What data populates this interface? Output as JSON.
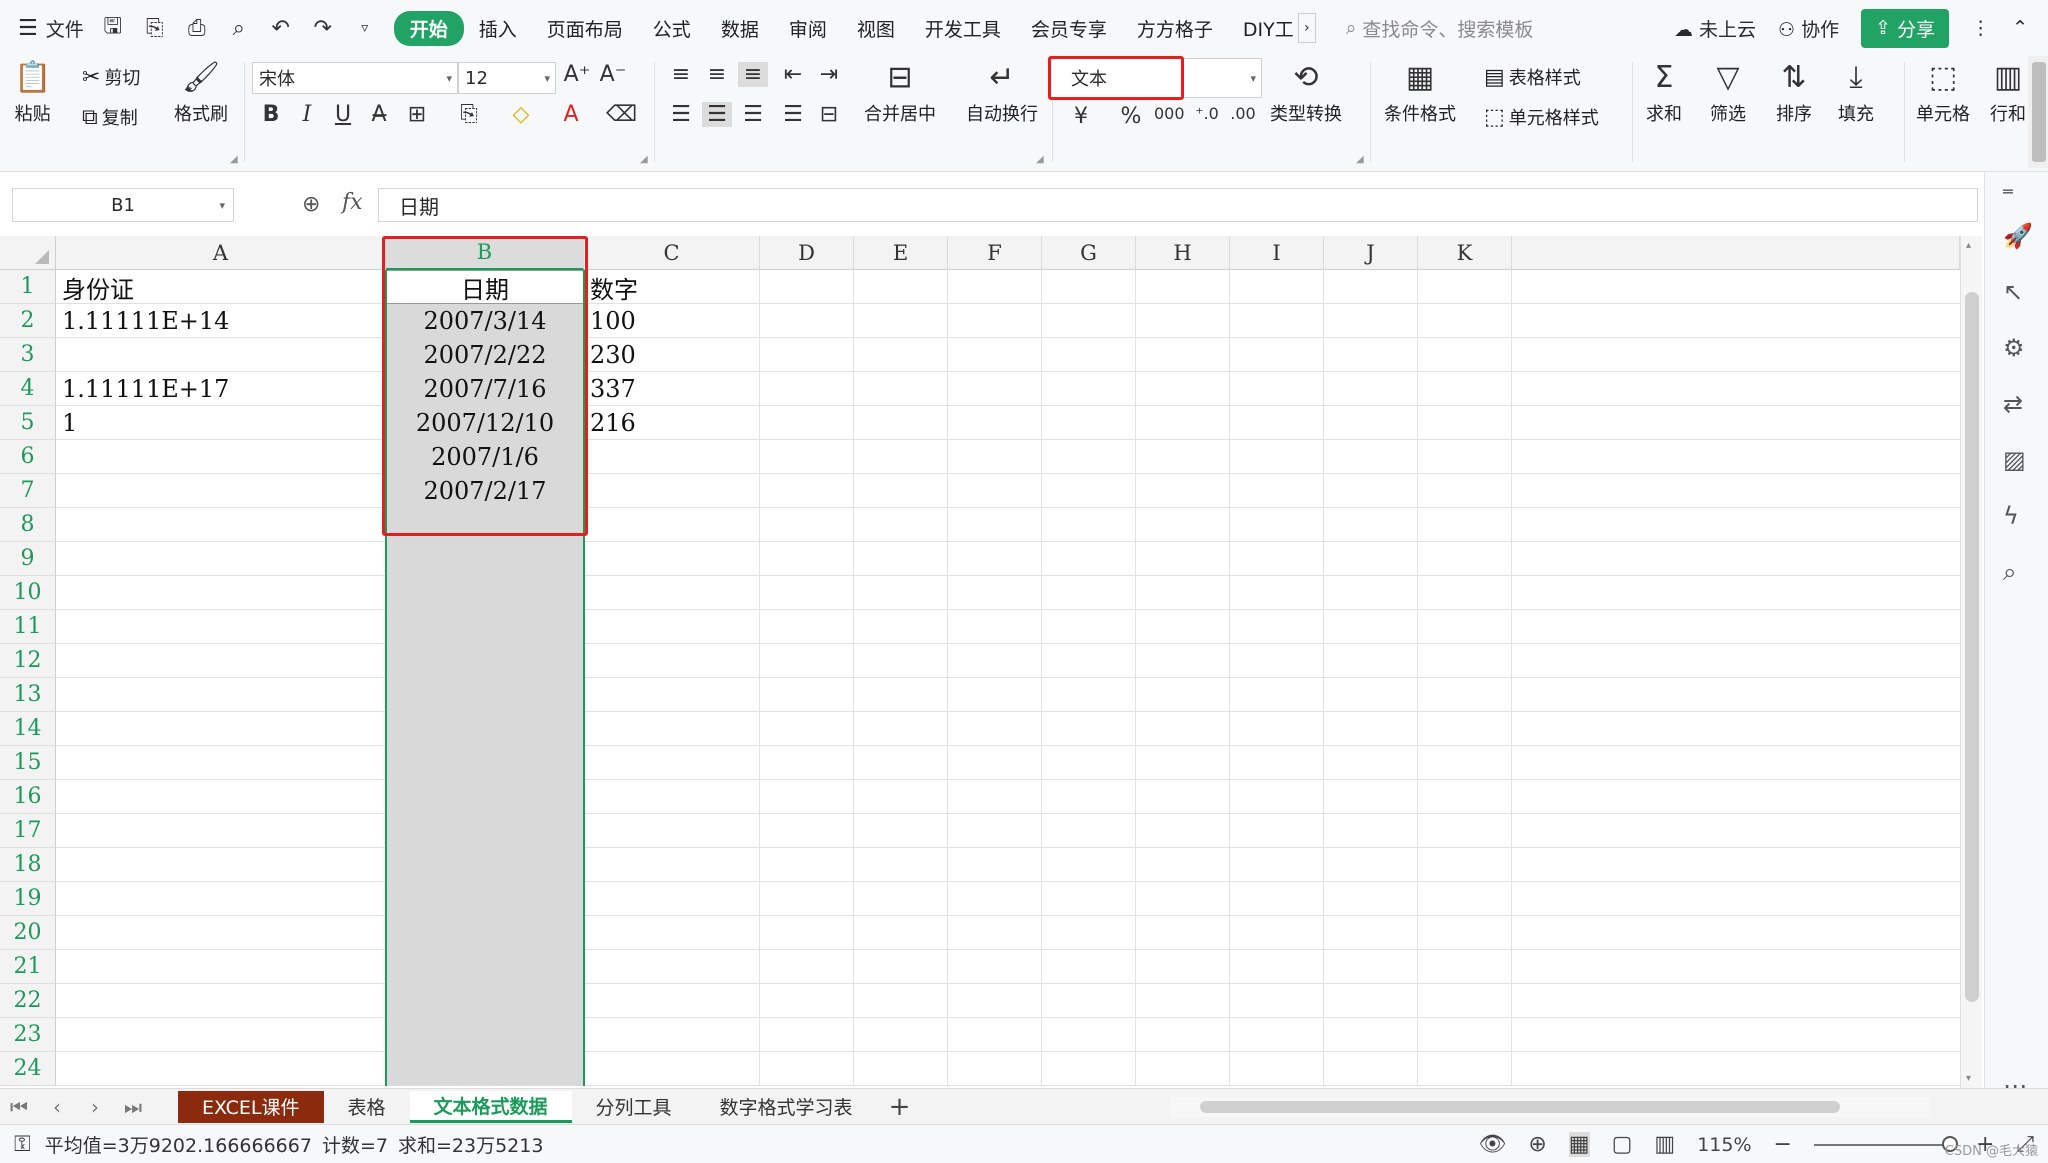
{
  "menubar": {
    "file_label": "文件",
    "tabs": [
      "开始",
      "插入",
      "页面布局",
      "公式",
      "数据",
      "审阅",
      "视图",
      "开发工具",
      "会员专享",
      "方方格子",
      "DIY工"
    ],
    "active_tab": "开始",
    "search_placeholder": "查找命令、搜索模板",
    "cloud_label": "未上云",
    "collab_label": "协作",
    "share_label": "分享"
  },
  "ribbon": {
    "paste_label": "粘贴",
    "cut_label": "剪切",
    "copy_label": "复制",
    "format_painter_label": "格式刷",
    "font_name": "宋体",
    "font_size": "12",
    "merge_label": "合并居中",
    "wrap_label": "自动换行",
    "number_format": "文本",
    "type_convert_label": "类型转换",
    "cond_format_label": "条件格式",
    "table_style_label": "表格样式",
    "cell_style_label": "单元格样式",
    "sum_label": "求和",
    "filter_label": "筛选",
    "sort_label": "排序",
    "fill_label": "填充",
    "cell_label": "单元格",
    "rowcol_label": "行和"
  },
  "formula_bar": {
    "name_box": "B1",
    "fx_label": "fx",
    "content": "日期"
  },
  "sheet": {
    "columns": [
      "A",
      "B",
      "C",
      "D",
      "E",
      "F",
      "G",
      "H",
      "I",
      "J",
      "K"
    ],
    "selected_column": "B",
    "rows": [
      "1",
      "2",
      "3",
      "4",
      "5",
      "6",
      "7",
      "8",
      "9",
      "10",
      "11",
      "12",
      "13",
      "14",
      "15",
      "16",
      "17",
      "18",
      "19",
      "20",
      "21",
      "22",
      "23",
      "24"
    ],
    "col_a": [
      "身份证",
      "1.11111E+14",
      "",
      "1.11111E+17",
      "1"
    ],
    "col_b": [
      "日期",
      "2007/3/14",
      "2007/2/22",
      "2007/7/16",
      "2007/12/10",
      "2007/1/6",
      "2007/2/17"
    ],
    "col_c": [
      "数字",
      "100",
      "230",
      "337",
      "216"
    ]
  },
  "sheet_tabs": [
    "EXCEL课件",
    "表格",
    "文本格式数据",
    "分列工具",
    "数字格式学习表"
  ],
  "active_sheet": "文本格式数据",
  "status": {
    "average": "平均值=3万9202.166666667",
    "count": "计数=7",
    "sum": "求和=23万5213",
    "zoom": "115%"
  },
  "watermark": "CSDN @毛大猿",
  "colors": {
    "accent": "#21a366",
    "selection_border": "#1b9a59",
    "highlight_red": "#e81e1e",
    "brown_tab": "#8b2a0c"
  }
}
